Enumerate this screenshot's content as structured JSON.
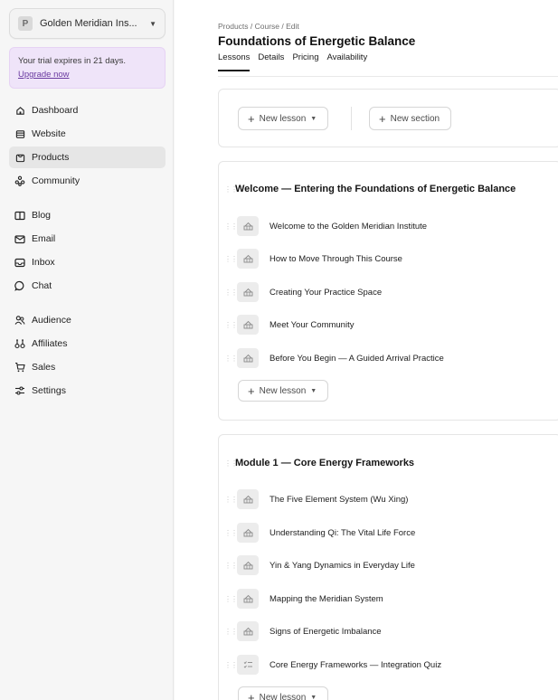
{
  "sidebar": {
    "workspace_initial": "P",
    "workspace_name": "Golden Meridian Ins...",
    "trial_text": "Your trial expires in 21 days.",
    "trial_link": "Upgrade now",
    "nav_group1": [
      {
        "label": "Dashboard",
        "icon": "home-icon"
      },
      {
        "label": "Website",
        "icon": "website-icon"
      },
      {
        "label": "Products",
        "icon": "products-icon",
        "active": true
      },
      {
        "label": "Community",
        "icon": "community-icon"
      }
    ],
    "nav_group2": [
      {
        "label": "Blog",
        "icon": "book-icon"
      },
      {
        "label": "Email",
        "icon": "mail-icon"
      },
      {
        "label": "Inbox",
        "icon": "inbox-icon"
      },
      {
        "label": "Chat",
        "icon": "chat-icon"
      }
    ],
    "nav_group3": [
      {
        "label": "Audience",
        "icon": "users-icon"
      },
      {
        "label": "Affiliates",
        "icon": "affiliates-icon"
      },
      {
        "label": "Sales",
        "icon": "cart-icon"
      },
      {
        "label": "Settings",
        "icon": "sliders-icon"
      }
    ]
  },
  "header": {
    "breadcrumb": "Products / Course / Edit",
    "title": "Foundations of Energetic Balance",
    "tabs": [
      "Lessons",
      "Details",
      "Pricing",
      "Availability"
    ],
    "active_tab": "Lessons"
  },
  "toolbar": {
    "new_lesson": "New lesson",
    "new_section": "New section"
  },
  "modules": [
    {
      "title": "Welcome — Entering the Foundations of Energetic Balance",
      "lessons": [
        {
          "title": "Welcome to the Golden Meridian Institute",
          "type": "video"
        },
        {
          "title": "How to Move Through This Course",
          "type": "video"
        },
        {
          "title": "Creating Your Practice Space",
          "type": "video"
        },
        {
          "title": "Meet Your Community",
          "type": "video"
        },
        {
          "title": "Before You Begin — A Guided Arrival Practice",
          "type": "video"
        }
      ],
      "new_lesson": "New lesson"
    },
    {
      "title": "Module 1 — Core Energy Frameworks",
      "lessons": [
        {
          "title": "The Five Element System (Wu Xing)",
          "type": "video"
        },
        {
          "title": "Understanding Qi: The Vital Life Force",
          "type": "video"
        },
        {
          "title": "Yin & Yang Dynamics in Everyday Life",
          "type": "video"
        },
        {
          "title": "Mapping the Meridian System",
          "type": "video"
        },
        {
          "title": "Signs of Energetic Imbalance",
          "type": "video"
        },
        {
          "title": "Core Energy Frameworks — Integration Quiz",
          "type": "quiz"
        }
      ],
      "new_lesson": "New lesson"
    }
  ],
  "colors": {
    "trial_bg": "#efe4f9",
    "trial_link": "#6a3aa0",
    "active_nav": "#e6e6e6"
  }
}
